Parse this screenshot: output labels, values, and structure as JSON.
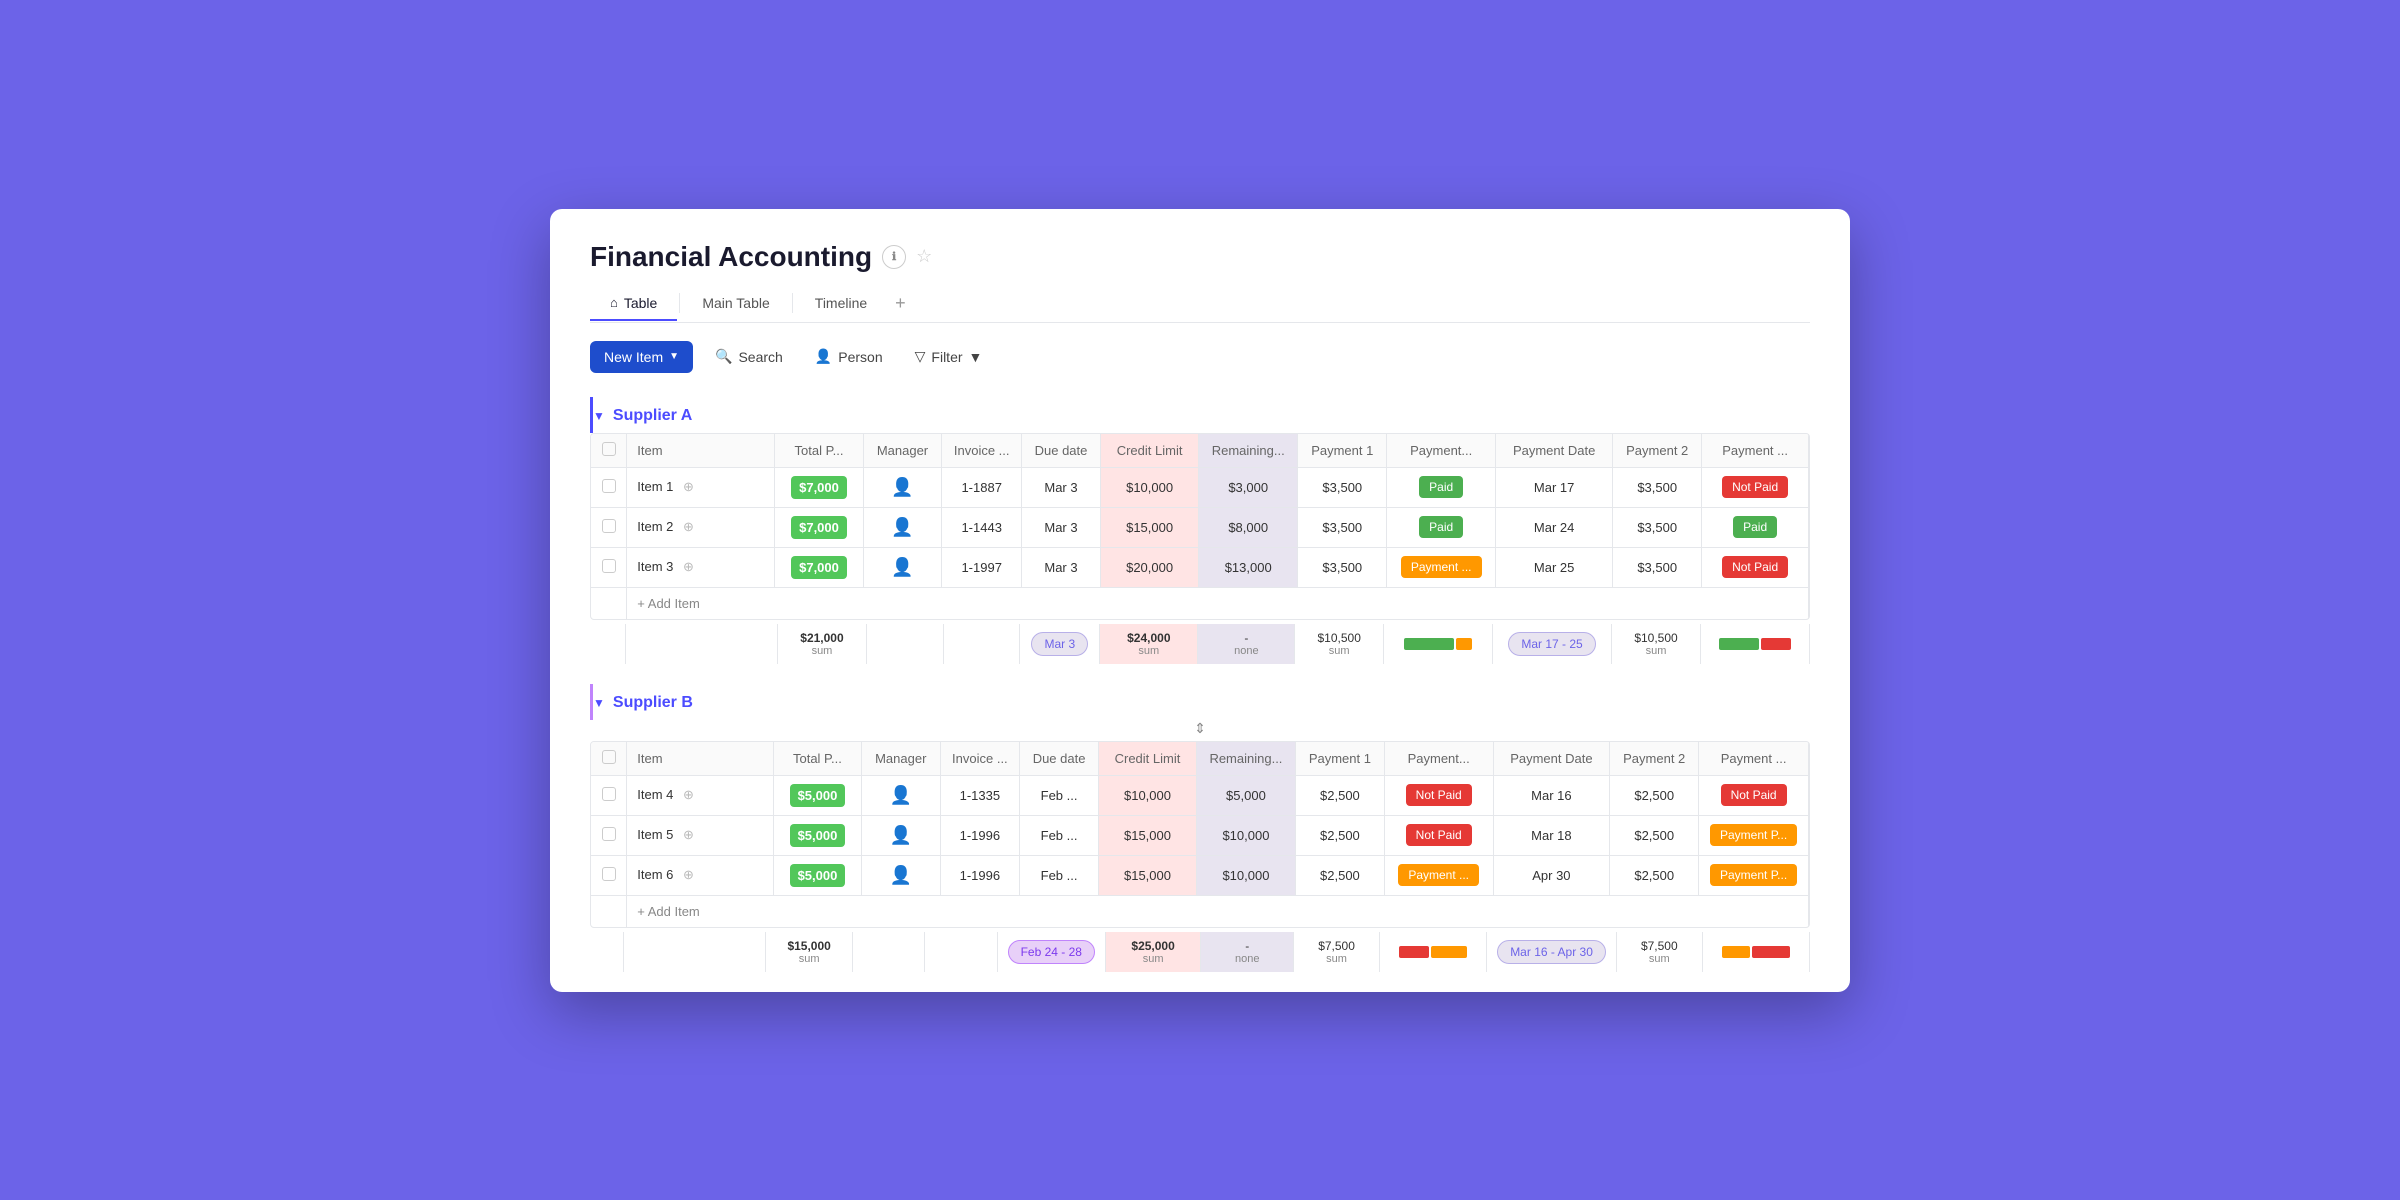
{
  "app": {
    "title": "Financial Accounting",
    "info_icon": "ℹ",
    "star_icon": "☆"
  },
  "tabs": [
    {
      "id": "table",
      "label": "Table",
      "icon": "⌂",
      "active": true
    },
    {
      "id": "main-table",
      "label": "Main Table",
      "active": false
    },
    {
      "id": "timeline",
      "label": "Timeline",
      "active": false
    }
  ],
  "toolbar": {
    "new_item_label": "New Item",
    "search_label": "Search",
    "person_label": "Person",
    "filter_label": "Filter"
  },
  "supplier_a": {
    "name": "Supplier A",
    "columns": [
      "Item",
      "Total P...",
      "Manager",
      "Invoice ...",
      "Due date",
      "Credit Limit",
      "Remaining...",
      "Payment 1",
      "Payment...",
      "Payment Date",
      "Payment 2",
      "Payment ..."
    ],
    "rows": [
      {
        "item": "Item 1",
        "total": "$7,000",
        "manager": "",
        "invoice": "1-1887",
        "due": "Mar 3",
        "credit": "$10,000",
        "remaining": "$3,000",
        "pay1": "$3,500",
        "paystat1": "Paid",
        "paystat1_type": "paid",
        "paydate": "Mar 17",
        "pay2": "$3,500",
        "paystat2": "Not Paid",
        "paystat2_type": "not-paid"
      },
      {
        "item": "Item 2",
        "total": "$7,000",
        "manager": "",
        "invoice": "1-1443",
        "due": "Mar 3",
        "credit": "$15,000",
        "remaining": "$8,000",
        "pay1": "$3,500",
        "paystat1": "Paid",
        "paystat1_type": "paid",
        "paydate": "Mar 24",
        "pay2": "$3,500",
        "paystat2": "Paid",
        "paystat2_type": "paid"
      },
      {
        "item": "Item 3",
        "total": "$7,000",
        "manager": "",
        "invoice": "1-1997",
        "due": "Mar 3",
        "credit": "$20,000",
        "remaining": "$13,000",
        "pay1": "$3,500",
        "paystat1": "Payment ...",
        "paystat1_type": "payment-p",
        "paydate": "Mar 25",
        "pay2": "$3,500",
        "paystat2": "Not Paid",
        "paystat2_type": "not-paid"
      }
    ],
    "summary": {
      "total": "$21,000",
      "total_label": "sum",
      "due": "Mar 3",
      "credit": "$24,000",
      "credit_label": "sum",
      "remaining_label": "none",
      "remaining": "-",
      "pay1": "$10,500",
      "pay1_label": "sum",
      "paydate": "Mar 17 - 25",
      "pay2": "$10,500",
      "pay2_label": "sum"
    }
  },
  "supplier_b": {
    "name": "Supplier B",
    "rows": [
      {
        "item": "Item 4",
        "total": "$5,000",
        "manager": "",
        "invoice": "1-1335",
        "due": "Feb ...",
        "credit": "$10,000",
        "remaining": "$5,000",
        "pay1": "$2,500",
        "paystat1": "Not Paid",
        "paystat1_type": "not-paid",
        "paydate": "Mar 16",
        "pay2": "$2,500",
        "paystat2": "Not Paid",
        "paystat2_type": "not-paid"
      },
      {
        "item": "Item 5",
        "total": "$5,000",
        "manager": "",
        "invoice": "1-1996",
        "due": "Feb ...",
        "credit": "$15,000",
        "remaining": "$10,000",
        "pay1": "$2,500",
        "paystat1": "Not Paid",
        "paystat1_type": "not-paid",
        "paydate": "Mar 18",
        "pay2": "$2,500",
        "paystat2": "Payment P...",
        "paystat2_type": "payment-p"
      },
      {
        "item": "Item 6",
        "total": "$5,000",
        "manager": "",
        "invoice": "1-1996",
        "due": "Feb ...",
        "credit": "$15,000",
        "remaining": "$10,000",
        "pay1": "$2,500",
        "paystat1": "Payment ...",
        "paystat1_type": "payment-p",
        "paydate": "Apr 30",
        "pay2": "$2,500",
        "paystat2": "Payment P...",
        "paystat2_type": "payment-p"
      }
    ],
    "summary": {
      "total": "$15,000",
      "total_label": "sum",
      "due": "Feb 24 - 28",
      "credit": "$25,000",
      "credit_label": "sum",
      "remaining_label": "none",
      "remaining": "-",
      "pay1": "$7,500",
      "pay1_label": "sum",
      "paydate": "Mar 16 - Apr 30",
      "pay2": "$7,500",
      "pay2_label": "sum"
    }
  },
  "add_item_label": "+ Add Item",
  "colors": {
    "accent": "#4c4cff",
    "paid_green": "#4caf50",
    "not_paid_red": "#e53935",
    "payment_orange": "#ff9800",
    "total_green": "#52c75a"
  }
}
